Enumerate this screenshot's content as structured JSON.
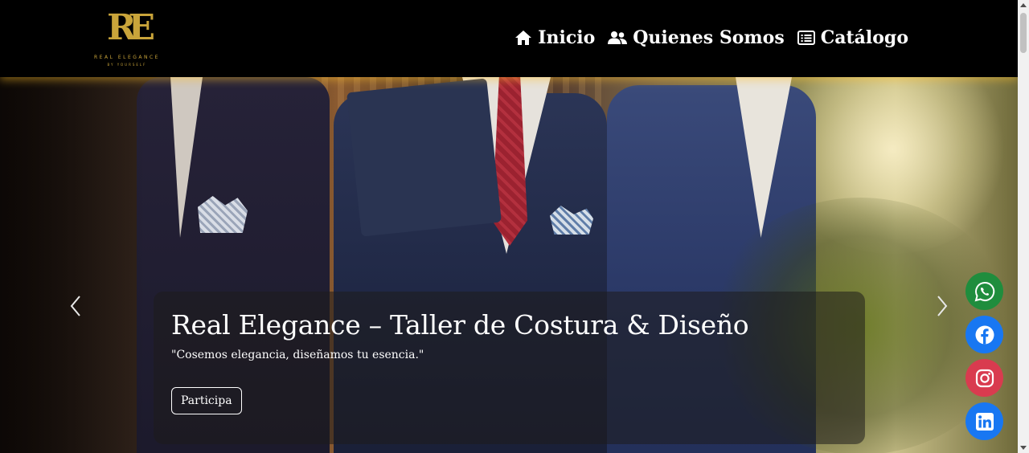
{
  "header": {
    "logo": {
      "mark": "RE",
      "name": "REAL ELEGANCE",
      "sub": "BY YOURSELF",
      "color": "#c9a43a"
    },
    "nav": [
      {
        "icon": "home-icon",
        "label": "Inicio"
      },
      {
        "icon": "users-icon",
        "label": "Quienes Somos"
      },
      {
        "icon": "list-icon",
        "label": "Catálogo"
      }
    ]
  },
  "hero": {
    "title": "Real Elegance – Taller de Costura & Diseño",
    "subtitle": "\"Cosemos elegancia, diseñamos tu esencia.\"",
    "button_label": "Participa"
  },
  "social": [
    {
      "name": "whatsapp",
      "color": "#1f8d3d"
    },
    {
      "name": "facebook",
      "color": "#1877f2"
    },
    {
      "name": "instagram",
      "color": "#d93b4f"
    },
    {
      "name": "linkedin",
      "color": "#1877f2"
    }
  ]
}
